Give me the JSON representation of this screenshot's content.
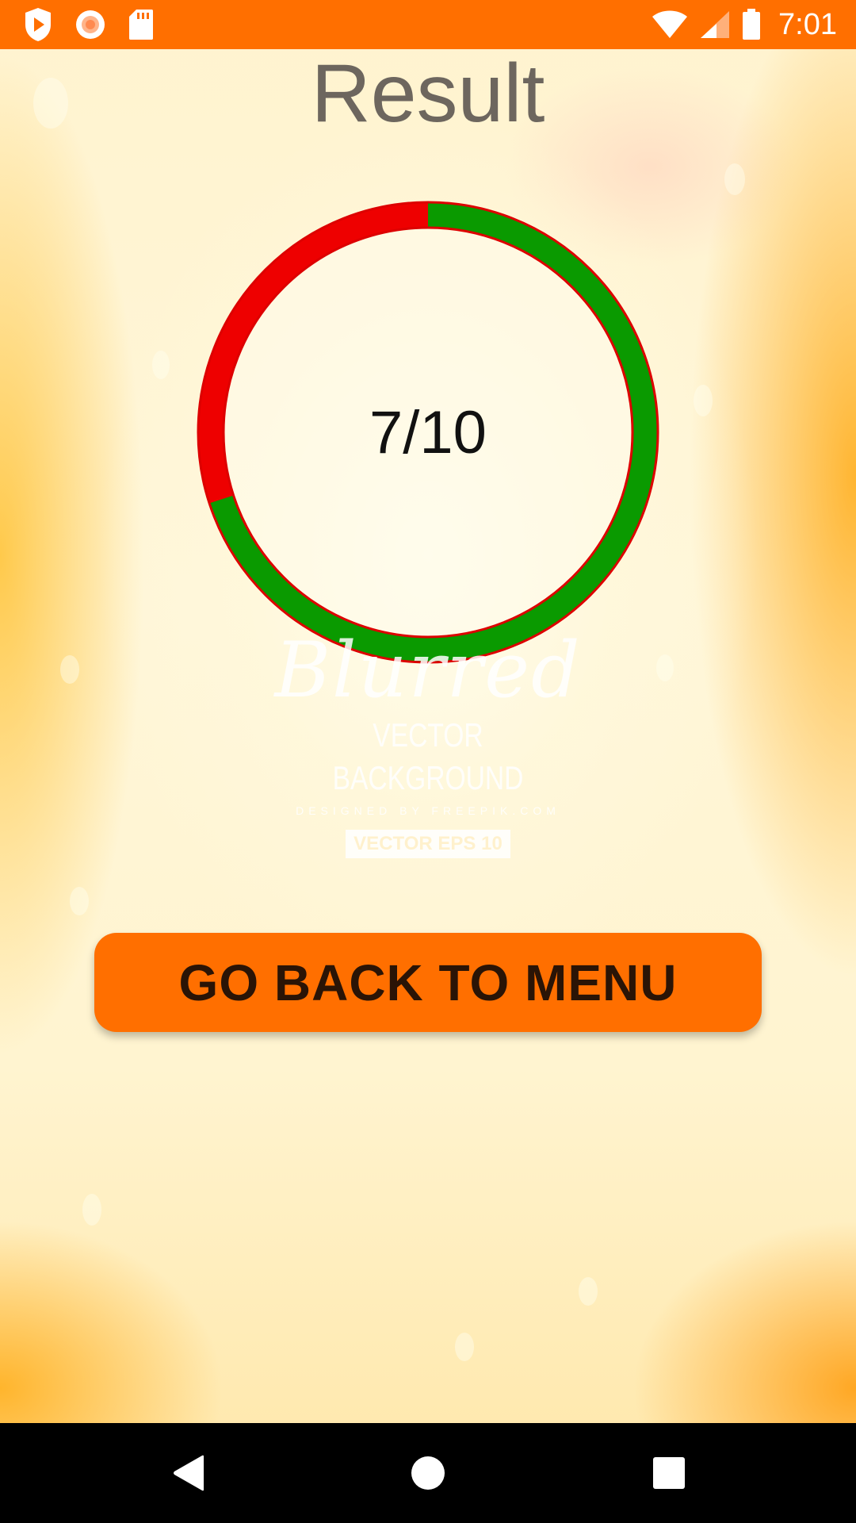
{
  "status_bar": {
    "time": "7:01",
    "icons": [
      "play-shield-icon",
      "record-icon",
      "sd-card-icon",
      "wifi-icon",
      "signal-icon",
      "battery-icon"
    ],
    "background_color": "#ff6f00"
  },
  "screen": {
    "title": "Result"
  },
  "score": {
    "text": "7/10",
    "correct": 7,
    "total": 10,
    "correct_color": "#0a9a00",
    "incorrect_color": "#ee0000"
  },
  "background_watermark": {
    "title": "Blurred",
    "subtitle": "VECTOR BACKGROUND",
    "small": "DESIGNED BY FREEPIK.COM",
    "badge": "VECTOR EPS 10"
  },
  "menu_button": {
    "label": "GO BACK TO MENU",
    "background_color": "#ff6f00"
  },
  "nav_bar": {
    "items": [
      "back-icon",
      "home-icon",
      "recents-icon"
    ]
  }
}
